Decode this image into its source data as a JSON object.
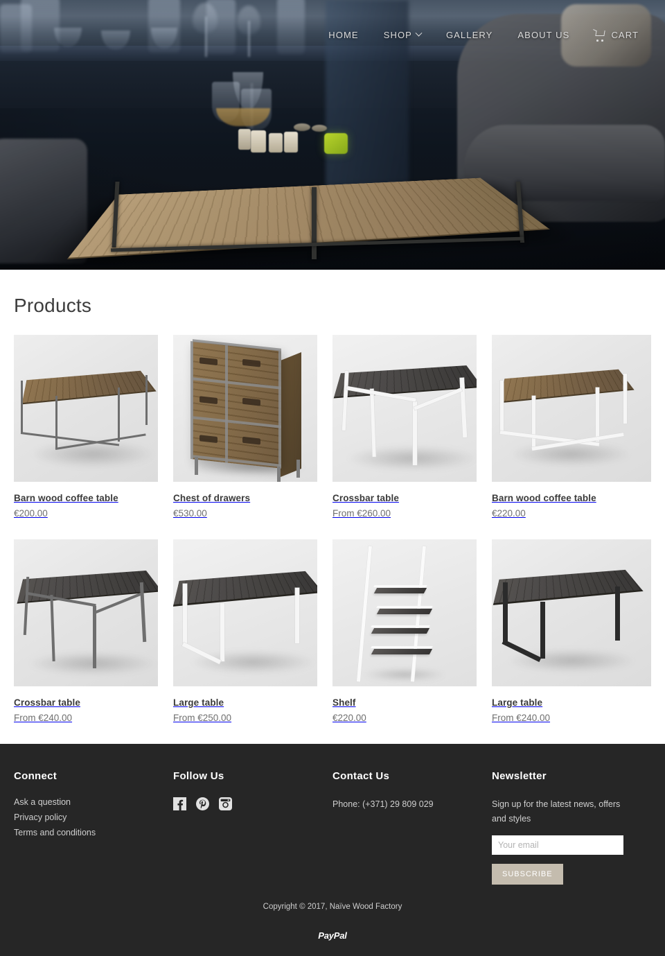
{
  "nav": {
    "items": [
      {
        "label": "HOME",
        "icon": null,
        "caret": false
      },
      {
        "label": "SHOP",
        "icon": null,
        "caret": true
      },
      {
        "label": "GALLERY",
        "icon": null,
        "caret": false
      },
      {
        "label": "ABOUT US",
        "icon": null,
        "caret": false
      },
      {
        "label": "CART",
        "icon": "shopping-cart-icon",
        "caret": false
      }
    ]
  },
  "hero": {
    "alt": "Dark interior with reclaimed wood and steel coffee table, wine glasses and candles"
  },
  "main": {
    "page_title": "Products",
    "products": [
      {
        "title": "Barn wood coffee table",
        "price": "€200.00",
        "image": "barn-wood-coffee-table-metal"
      },
      {
        "title": "Chest of drawers",
        "price": "€530.00",
        "image": "chest-of-drawers"
      },
      {
        "title": "Crossbar table",
        "price": "From €260.00",
        "image": "crossbar-table-white"
      },
      {
        "title": "Barn wood coffee table",
        "price": "€220.00",
        "image": "barn-wood-coffee-table-white"
      },
      {
        "title": "Crossbar table",
        "price": "From €240.00",
        "image": "crossbar-table-metal"
      },
      {
        "title": "Large table",
        "price": "From €250.00",
        "image": "large-table-white"
      },
      {
        "title": "Shelf",
        "price": "€220.00",
        "image": "ladder-shelf"
      },
      {
        "title": "Large table",
        "price": "From €240.00",
        "image": "large-table-black"
      }
    ]
  },
  "footer": {
    "connect": {
      "heading": "Connect",
      "links": [
        "Ask a question",
        "Privacy policy",
        "Terms and conditions"
      ]
    },
    "follow": {
      "heading": "Follow Us",
      "socials": [
        "facebook-icon",
        "pinterest-icon",
        "instagram-icon"
      ]
    },
    "contact": {
      "heading": "Contact Us",
      "phone": "Phone: (+371) 29 809 029"
    },
    "newsletter": {
      "heading": "Newsletter",
      "description": "Sign up for the latest news, offers and styles",
      "email_placeholder": "Your email",
      "email_value": "",
      "subscribe_label": "SUBSCRIBE"
    },
    "copyright": "Copyright © 2017, Naïve Wood Factory",
    "payment": "PayPal"
  },
  "colors": {
    "footer_bg": "#262626",
    "subscribe_bg": "#c4bcae",
    "text_dark": "#3b3b3b",
    "price": "#6f6f6f"
  }
}
